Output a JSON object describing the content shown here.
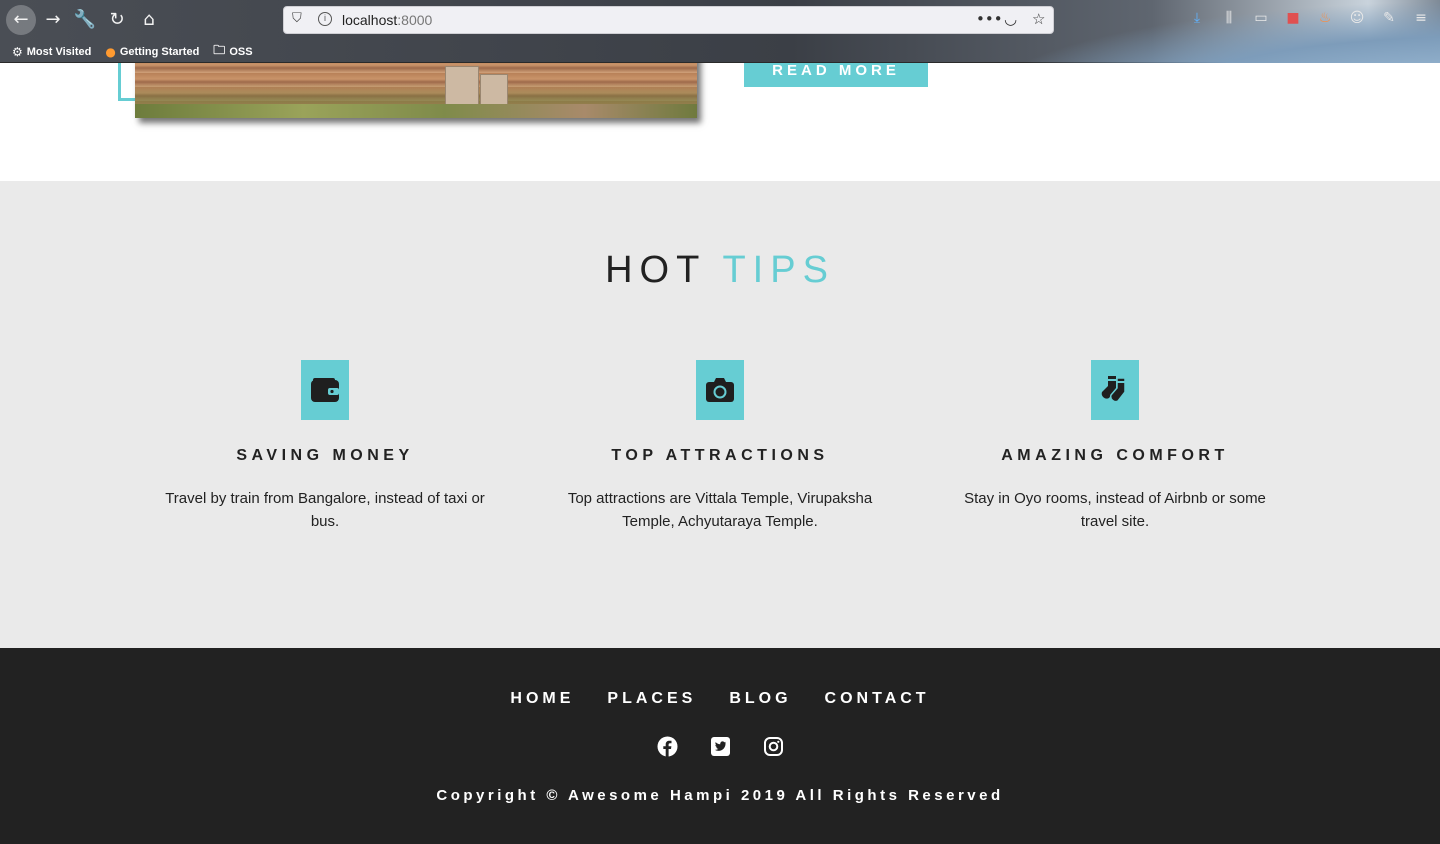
{
  "browser": {
    "url_host": "localhost",
    "url_port": ":8000",
    "bookmarks": [
      {
        "label": "Most Visited",
        "icon": "gear-icon"
      },
      {
        "label": "Getting Started",
        "icon": "firefox-icon"
      },
      {
        "label": "OSS",
        "icon": "folder-icon"
      }
    ]
  },
  "page_top": {
    "read_more_label": "READ MORE"
  },
  "tips": {
    "title_main": "HOT",
    "title_accent": "TIPS",
    "items": [
      {
        "icon": "wallet-icon",
        "heading": "SAVING MONEY",
        "text": "Travel by train from Bangalore, instead of taxi or bus."
      },
      {
        "icon": "camera-icon",
        "heading": "TOP ATTRACTIONS",
        "text": "Top attractions are Vittala Temple, Virupaksha Temple, Achyutaraya Temple."
      },
      {
        "icon": "socks-icon",
        "heading": "AMAZING COMFORT",
        "text": "Stay in Oyo rooms, instead of Airbnb or some travel site."
      }
    ]
  },
  "footer": {
    "nav": [
      "HOME",
      "PLACES",
      "BLOG",
      "CONTACT"
    ],
    "socials": [
      "facebook-icon",
      "twitter-icon",
      "instagram-icon"
    ],
    "copyright": "Copyright © Awesome Hampi 2019 All Rights Reserved"
  },
  "colors": {
    "accent": "#66cdd3",
    "tips_bg": "#eaeaea",
    "footer_bg": "#222222",
    "text": "#222222"
  }
}
